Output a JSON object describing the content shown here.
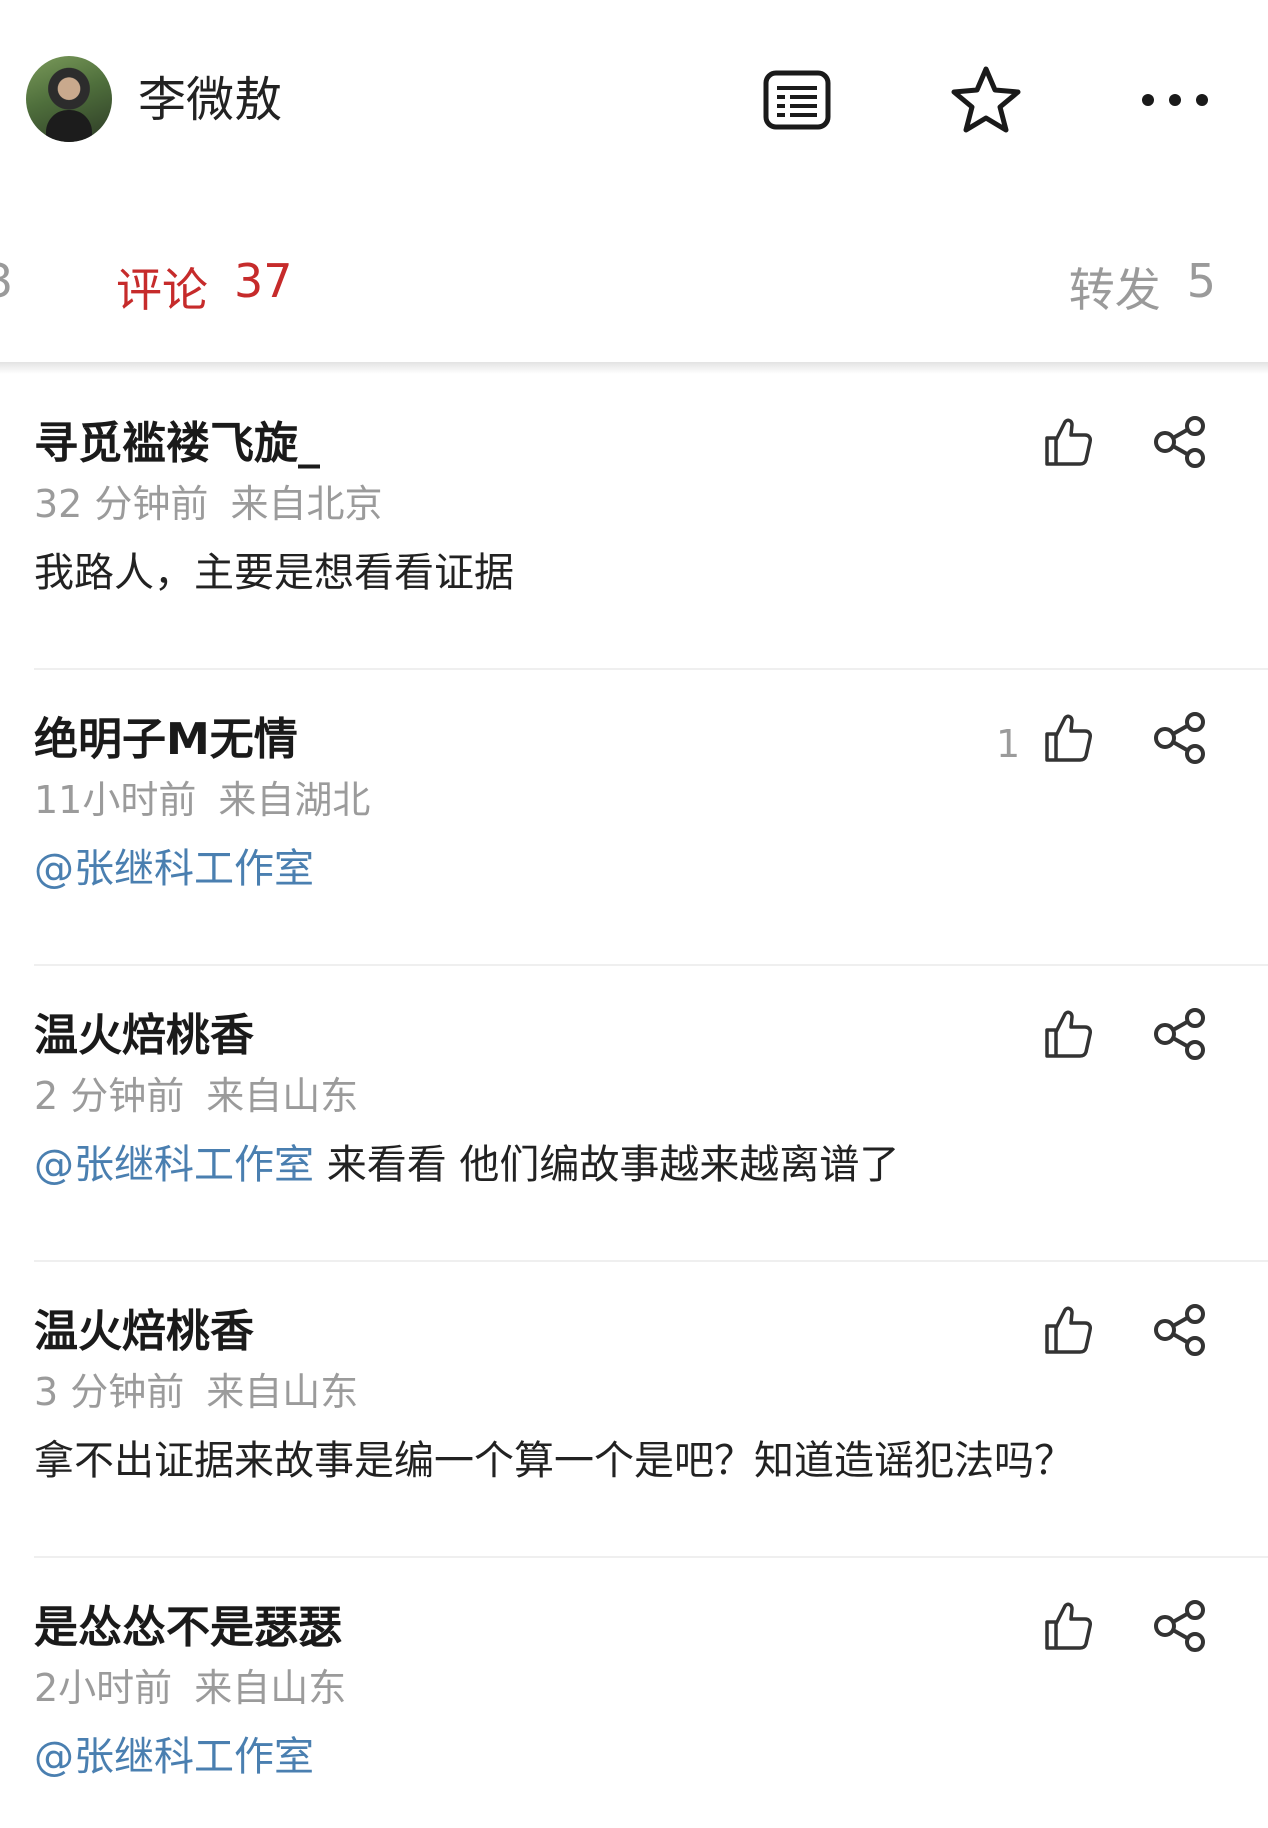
{
  "header": {
    "user_name": "李微敖",
    "icons": [
      "reader-icon",
      "star-icon",
      "more-icon"
    ]
  },
  "tabs": {
    "left_cut_label": "3",
    "comments_label": "评论",
    "comments_count": "37",
    "reposts_label": "转发",
    "reposts_count": "5"
  },
  "colors": {
    "active_tab": "#c62b2b",
    "mention": "#4a7fb0",
    "meta": "#9b9b9b"
  },
  "comments": [
    {
      "user": "寻觅褴褛飞旋_",
      "time": "32 分钟前",
      "location": "来自北京",
      "mention": "",
      "text": "我路人，主要是想看看证据",
      "likes": ""
    },
    {
      "user": "绝明子M无情",
      "time": "11小时前",
      "location": "来自湖北",
      "mention": "@张继科工作室",
      "text": "",
      "likes": "1"
    },
    {
      "user": "温火焙桃香",
      "time": "2 分钟前",
      "location": "来自山东",
      "mention": "@张继科工作室",
      "text": " 来看看 他们编故事越来越离谱了",
      "likes": ""
    },
    {
      "user": "温火焙桃香",
      "time": "3 分钟前",
      "location": "来自山东",
      "mention": "",
      "text": "拿不出证据来故事是编一个算一个是吧？知道造谣犯法吗？",
      "likes": ""
    },
    {
      "user": "是怂怂不是瑟瑟",
      "time": "2小时前",
      "location": "来自山东",
      "mention": "@张继科工作室",
      "text": "",
      "likes": ""
    }
  ]
}
